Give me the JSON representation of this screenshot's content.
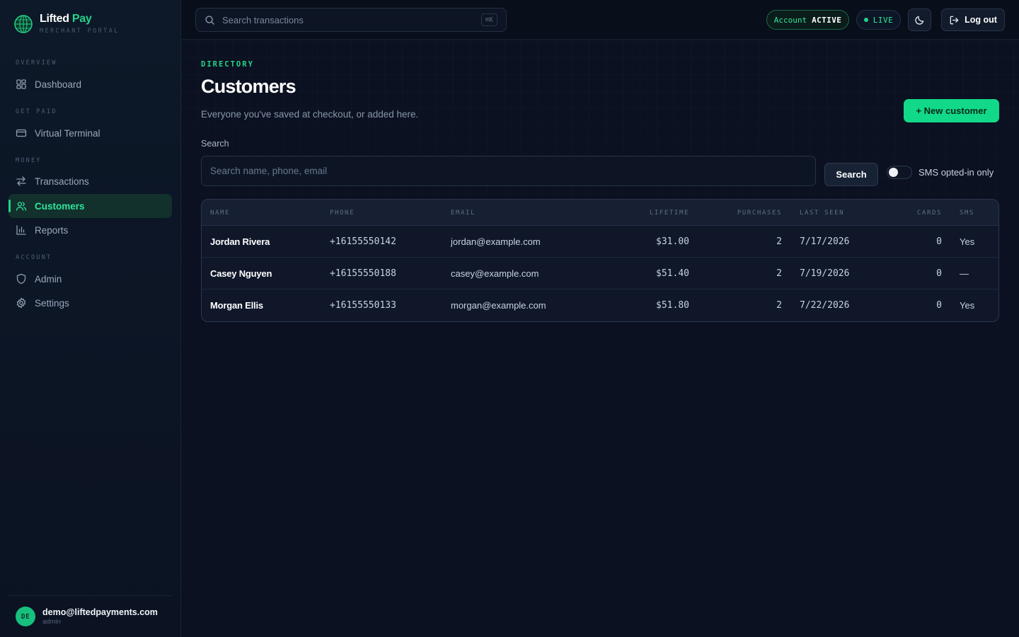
{
  "brand": {
    "name_part1": "Lifted",
    "name_part2": "Pay",
    "subtitle": "MERCHANT PORTAL"
  },
  "sidebar": {
    "sections": [
      {
        "label": "OVERVIEW"
      },
      {
        "label": "GET PAID"
      },
      {
        "label": "MONEY"
      },
      {
        "label": "ACCOUNT"
      }
    ],
    "items": [
      {
        "label": "Dashboard",
        "icon": "grid-icon"
      },
      {
        "label": "Virtual Terminal",
        "icon": "card-icon"
      },
      {
        "label": "Transactions",
        "icon": "arrows-icon"
      },
      {
        "label": "Customers",
        "icon": "users-icon",
        "active": true
      },
      {
        "label": "Reports",
        "icon": "bar-chart-icon"
      },
      {
        "label": "Admin",
        "icon": "shield-icon"
      },
      {
        "label": "Settings",
        "icon": "gear-icon"
      }
    ],
    "user": {
      "initials": "DE",
      "email": "demo@liftedpayments.com",
      "role": "admin"
    }
  },
  "topbar": {
    "search_placeholder": "Search transactions",
    "shortcut": "⌘K",
    "account_label": "Account",
    "account_status": "ACTIVE",
    "mode": "LIVE",
    "logout_label": "Log out"
  },
  "page": {
    "eyebrow": "DIRECTORY",
    "title": "Customers",
    "subtitle": "Everyone you've saved at checkout, or added here.",
    "new_button": "+ New customer",
    "search_label": "Search",
    "search_placeholder": "Search name, phone, email",
    "search_value": "",
    "search_button": "Search",
    "sms_toggle_label": "SMS opted-in only",
    "sms_toggle_on": false
  },
  "table": {
    "columns": [
      "NAME",
      "PHONE",
      "EMAIL",
      "LIFETIME",
      "PURCHASES",
      "LAST SEEN",
      "CARDS",
      "SMS"
    ],
    "rows": [
      {
        "name": "Jordan Rivera",
        "phone": "+16155550142",
        "email": "jordan@example.com",
        "lifetime": "$31.00",
        "purchases": "2",
        "last_seen": "7/17/2026",
        "cards": "0",
        "sms": "Yes"
      },
      {
        "name": "Casey Nguyen",
        "phone": "+16155550188",
        "email": "casey@example.com",
        "lifetime": "$51.40",
        "purchases": "2",
        "last_seen": "7/19/2026",
        "cards": "0",
        "sms": "—"
      },
      {
        "name": "Morgan Ellis",
        "phone": "+16155550133",
        "email": "morgan@example.com",
        "lifetime": "$51.80",
        "purchases": "2",
        "last_seen": "7/22/2026",
        "cards": "0",
        "sms": "Yes"
      }
    ]
  },
  "colors": {
    "accent": "#22d38a",
    "background": "#0b1120",
    "sidebar": "#0d1828"
  }
}
